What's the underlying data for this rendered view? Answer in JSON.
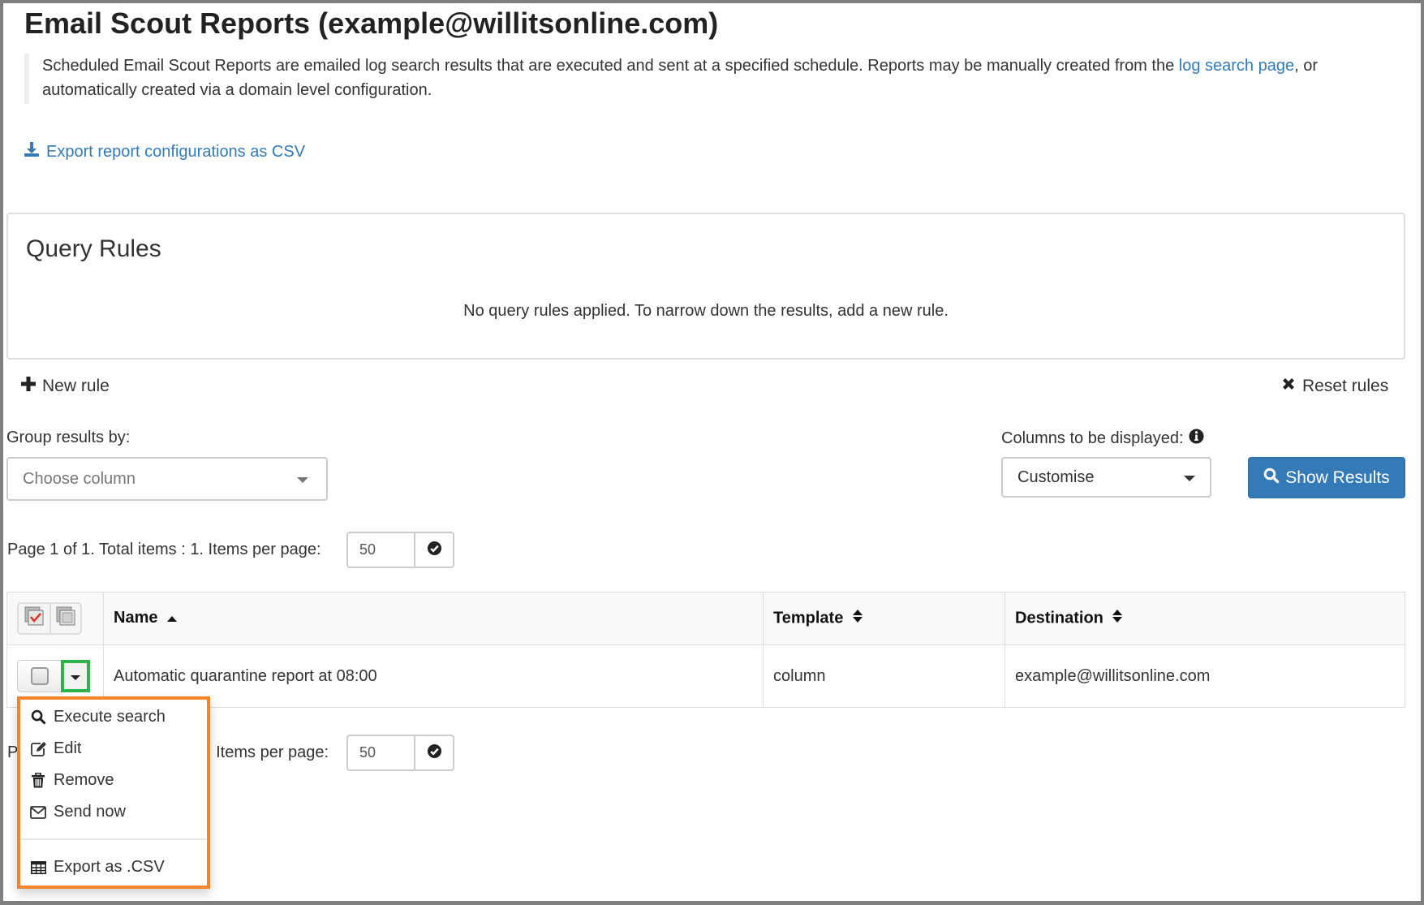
{
  "page": {
    "title": "Email Scout Reports (example@willitsonline.com)",
    "description_before_link": "Scheduled Email Scout Reports are emailed log search results that are executed and sent at a specified schedule. Reports may be manually created from the ",
    "description_link": "log search page",
    "description_after_link": ", or automatically created via a domain level configuration.",
    "export_link": "Export report configurations as CSV"
  },
  "query_rules": {
    "title": "Query Rules",
    "empty_message": "No query rules applied. To narrow down the results, add a new rule.",
    "new_rule": "New rule",
    "reset_rules": "Reset rules"
  },
  "filters": {
    "group_by_label": "Group results by:",
    "group_by_placeholder": "Choose column",
    "columns_label": "Columns to be displayed:",
    "columns_value": "Customise",
    "show_results": "Show Results"
  },
  "pager": {
    "summary_top": "Page 1 of 1. Total items : 1. Items per page:",
    "summary_bottom_visible_start": "P",
    "summary_bottom_visible_end": ". Items per page:",
    "items_per_page": "50"
  },
  "table": {
    "columns": [
      {
        "label": "Name",
        "sort": "asc"
      },
      {
        "label": "Template",
        "sort": "both"
      },
      {
        "label": "Destination",
        "sort": "both"
      }
    ],
    "rows": [
      {
        "name": "Automatic quarantine report at 08:00",
        "template": "column",
        "destination": "example@willitsonline.com"
      }
    ]
  },
  "row_menu": {
    "items": [
      {
        "label": "Execute search",
        "icon": "search-icon"
      },
      {
        "label": "Edit",
        "icon": "edit-icon"
      },
      {
        "label": "Remove",
        "icon": "trash-icon"
      },
      {
        "label": "Send now",
        "icon": "envelope-icon"
      },
      {
        "label": "Export as .CSV",
        "icon": "table-icon"
      }
    ]
  },
  "colors": {
    "link": "#337ab7",
    "primary": "#337ab7",
    "highlight_menu_border": "#f5832a",
    "highlight_toggle_border": "#2db34a"
  }
}
